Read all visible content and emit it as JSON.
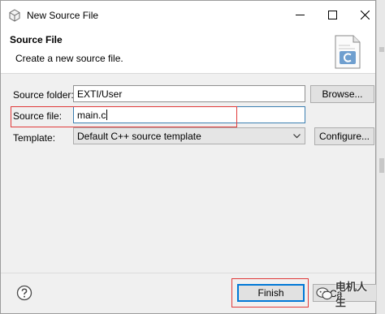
{
  "titlebar": {
    "title": "New Source File",
    "icon": "eclipse-wizard-icon",
    "controls": [
      "minimize-icon",
      "maximize-icon",
      "close-icon"
    ]
  },
  "header": {
    "title": "Source File",
    "description": "Create a new source file.",
    "icon": "c-source-file-icon"
  },
  "form": {
    "source_folder_label": "Source folder:",
    "source_folder_value": "EXTI/User",
    "browse_label": "Browse...",
    "source_file_label": "Source file:",
    "source_file_value": "main.c",
    "template_label": "Template:",
    "template_value": "Default C++ source template",
    "configure_label": "Configure..."
  },
  "footer": {
    "help_icon": "help-icon",
    "finish_label": "Finish",
    "cancel_label": "Ca"
  },
  "watermark": {
    "text": "电机人生",
    "icon": "wechat-icon"
  },
  "colors": {
    "highlight_box": "#e03a3a",
    "focus_border": "#3c7fb1",
    "default_button_border": "#0078d7",
    "dialog_bg": "#f0f0f0"
  }
}
